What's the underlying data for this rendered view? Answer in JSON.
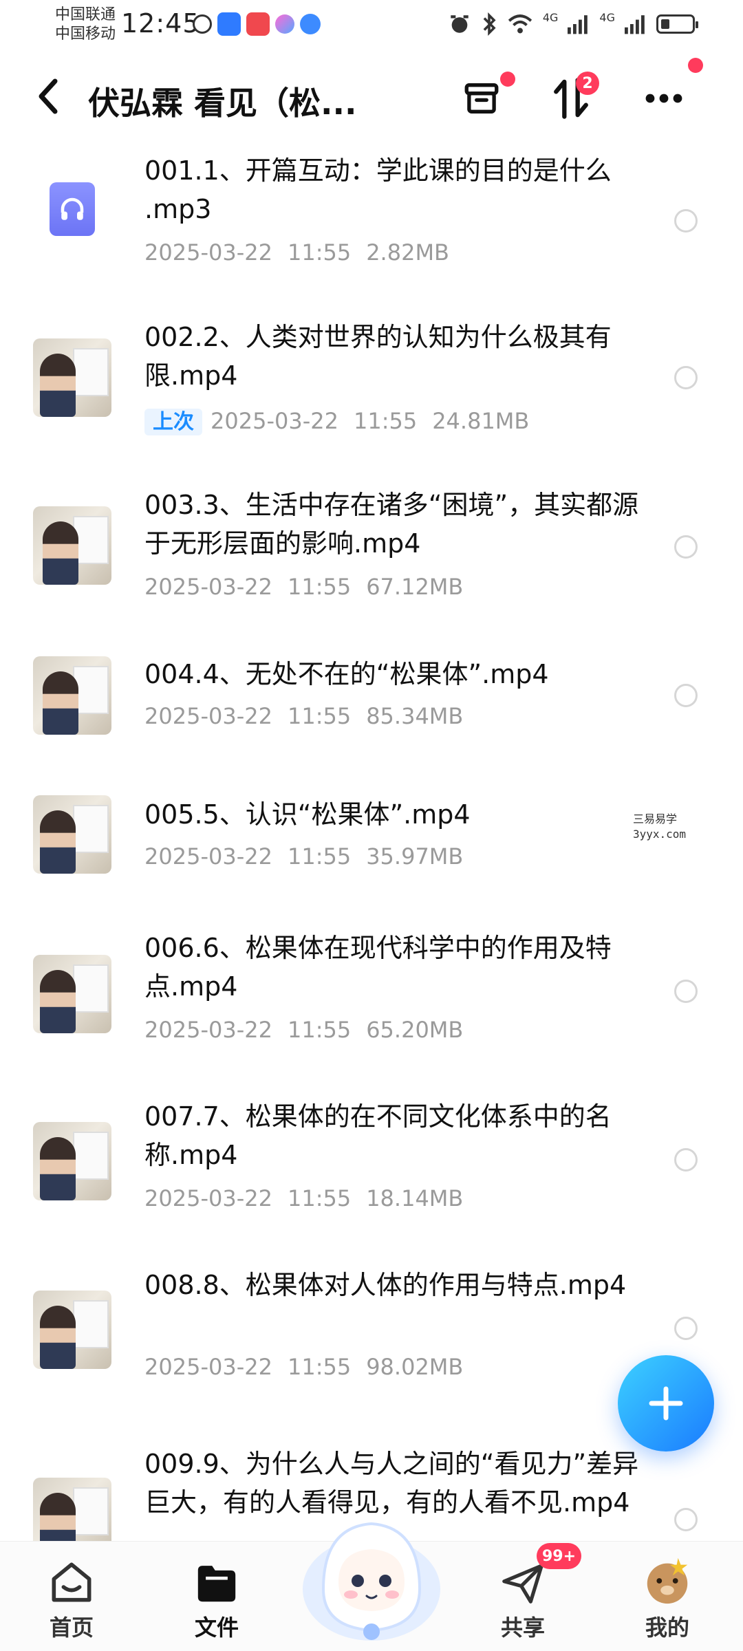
{
  "status_bar": {
    "carrier_1": "中国联通",
    "carrier_2": "中国移动",
    "time": "12:45",
    "network": "4G"
  },
  "header": {
    "title": "伏弘霖 看见（松...",
    "transfer_badge": "2"
  },
  "files": [
    {
      "name": "001.1、开篇互动：学此课的目的是什么 .mp3",
      "date": "2025-03-22",
      "time": "11:55",
      "size": "2.82MB",
      "tag": "",
      "type": "audio"
    },
    {
      "name": "002.2、人类对世界的认知为什么极其有限.mp4",
      "date": "2025-03-22",
      "time": "11:55",
      "size": "24.81MB",
      "tag": "上次",
      "type": "video"
    },
    {
      "name": "003.3、生活中存在诸多“困境”，其实都源于无形层面的影响.mp4",
      "date": "2025-03-22",
      "time": "11:55",
      "size": "67.12MB",
      "tag": "",
      "type": "video"
    },
    {
      "name": "004.4、无处不在的“松果体”.mp4",
      "date": "2025-03-22",
      "time": "11:55",
      "size": "85.34MB",
      "tag": "",
      "type": "video"
    },
    {
      "name": "005.5、认识“松果体”.mp4",
      "date": "2025-03-22",
      "time": "11:55",
      "size": "35.97MB",
      "tag": "",
      "type": "video"
    },
    {
      "name": "006.6、松果体在现代科学中的作用及特点.mp4",
      "date": "2025-03-22",
      "time": "11:55",
      "size": "65.20MB",
      "tag": "",
      "type": "video"
    },
    {
      "name": "007.7、松果体的在不同文化体系中的名称.mp4",
      "date": "2025-03-22",
      "time": "11:55",
      "size": "18.14MB",
      "tag": "",
      "type": "video"
    },
    {
      "name": "008.8、松果体对人体的作用与特点.mp4",
      "date": "2025-03-22",
      "time": "11:55",
      "size": "98.02MB",
      "tag": "",
      "type": "video"
    },
    {
      "name": "009.9、为什么人与人之间的“看见力”差异巨大，有的人看得见，有的人看不见.mp4",
      "date": "",
      "time": "",
      "size": "",
      "tag": "",
      "type": "video"
    }
  ],
  "watermark": {
    "line1": "三易易学",
    "line2": "3yyx.com"
  },
  "bottom_nav": {
    "home": "首页",
    "files": "文件",
    "share": "共享",
    "share_badge": "99+",
    "mine": "我的"
  },
  "colors": {
    "accent": "#1a8cff",
    "badge": "#ff3b5c",
    "fab": "#1a7bff"
  }
}
